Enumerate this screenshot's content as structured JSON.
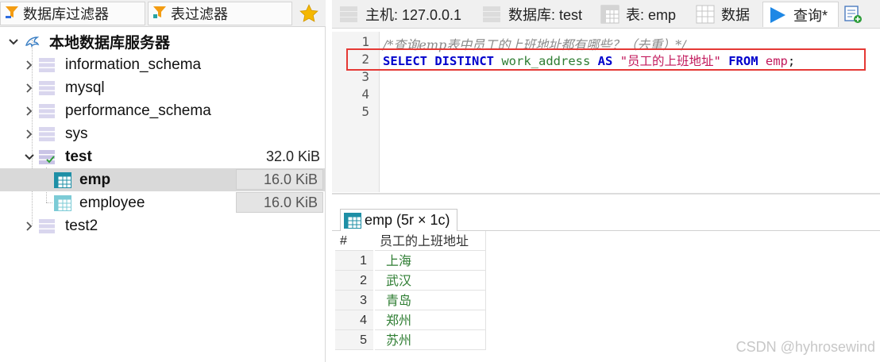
{
  "filters": {
    "db_filter": "数据库过滤器",
    "table_filter": "表过滤器"
  },
  "tree": {
    "root": "本地数据库服务器",
    "items": [
      {
        "label": "information_schema"
      },
      {
        "label": "mysql"
      },
      {
        "label": "performance_schema"
      },
      {
        "label": "sys"
      },
      {
        "label": "test",
        "size": "32.0 KiB"
      },
      {
        "label": "emp",
        "size": "16.0 KiB"
      },
      {
        "label": "employee",
        "size": "16.0 KiB"
      },
      {
        "label": "test2"
      }
    ]
  },
  "tabs": [
    {
      "label": "主机: 127.0.0.1"
    },
    {
      "label": "数据库: test"
    },
    {
      "label": "表: emp"
    },
    {
      "label": "数据"
    },
    {
      "label": "查询*"
    }
  ],
  "editor": {
    "line_numbers": [
      "1",
      "2",
      "3",
      "4",
      "5"
    ],
    "line1_comment": "/*查询emp表中员工的上班地址都有哪些？（去重）*/",
    "line2": {
      "kw_select": "SELECT",
      "kw_distinct": "DISTINCT",
      "column": "work_address",
      "kw_as": "AS",
      "alias": "\"员工的上班地址\"",
      "kw_from": "FROM",
      "table": "emp",
      "end": ";"
    }
  },
  "result": {
    "tab_label": "emp (5r × 1c)",
    "header_num": "#",
    "header_col": "员工的上班地址",
    "rows": [
      {
        "n": "1",
        "v": "上海"
      },
      {
        "n": "2",
        "v": "武汉"
      },
      {
        "n": "3",
        "v": "青岛"
      },
      {
        "n": "4",
        "v": "郑州"
      },
      {
        "n": "5",
        "v": "苏州"
      }
    ]
  },
  "watermark": "CSDN @hyhrosewind",
  "colors": {
    "accent": "#1e88e5",
    "highlight_border": "#e53935",
    "result_text": "#2e7d32"
  }
}
